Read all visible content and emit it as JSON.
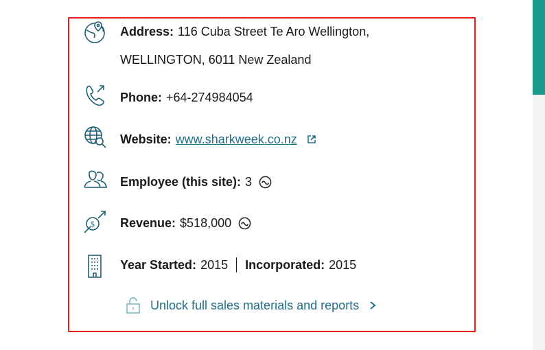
{
  "address": {
    "label": "Address:",
    "line1": "116 Cuba Street Te Aro Wellington,",
    "line2": "WELLINGTON, 6011 New Zealand",
    "icon": "location-globe-icon"
  },
  "phone": {
    "label": "Phone:",
    "value": "+64-274984054",
    "icon": "phone-icon"
  },
  "website": {
    "label": "Website:",
    "value": "www.sharkweek.co.nz",
    "icon": "globe-search-icon"
  },
  "employees": {
    "label": "Employee (this site):",
    "value": "3",
    "icon": "people-icon"
  },
  "revenue": {
    "label": "Revenue:",
    "value": "$518,000",
    "icon": "revenue-growth-icon"
  },
  "year": {
    "label": "Year Started:",
    "value": "2015",
    "incorporated_label": "Incorporated:",
    "incorporated_value": "2015",
    "icon": "building-icon"
  },
  "unlock": {
    "label": "Unlock full sales materials and reports",
    "icon": "unlock-icon"
  },
  "colors": {
    "accent": "#1f6f8b",
    "highlight_border": "#e02020",
    "scroll_thumb": "#1a9a8c"
  }
}
